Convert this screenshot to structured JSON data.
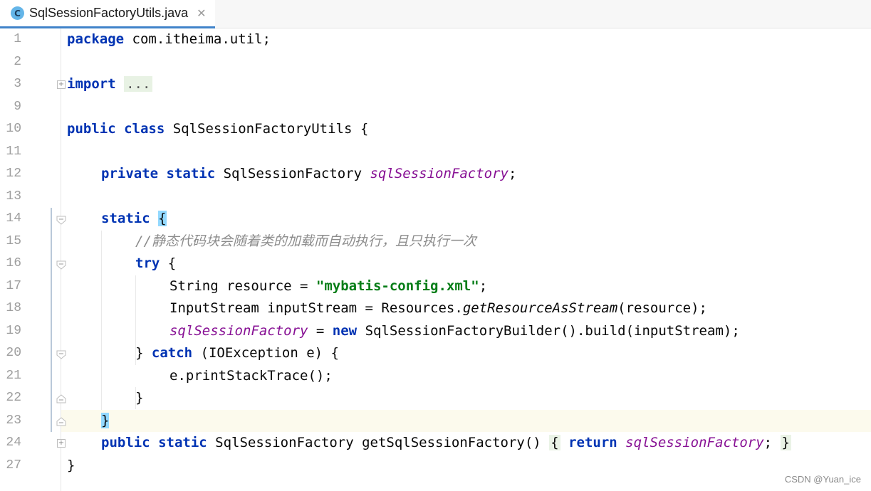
{
  "tab": {
    "icon_letter": "C",
    "title": "SqlSessionFactoryUtils.java",
    "close": "✕"
  },
  "line_numbers": [
    "1",
    "2",
    "3",
    "9",
    "10",
    "11",
    "12",
    "13",
    "14",
    "15",
    "16",
    "17",
    "18",
    "19",
    "20",
    "21",
    "22",
    "23",
    "24",
    "27"
  ],
  "code": {
    "l1_kw": "package",
    "l1_rest": " com.itheima.util;",
    "l3_kw": "import",
    "l3_folded": "...",
    "l10_kw1": "public",
    "l10_kw2": "class",
    "l10_rest": " SqlSessionFactoryUtils {",
    "l12_kw1": "private",
    "l12_kw2": "static",
    "l12_type": " SqlSessionFactory ",
    "l12_field": "sqlSessionFactory",
    "l12_end": ";",
    "l14_kw": "static",
    "l14_brace": "{",
    "l15_comment": "//静态代码块会随着类的加载而自动执行，且只执行一次",
    "l16_kw": "try",
    "l16_rest": " {",
    "l17_pre": "String resource = ",
    "l17_str": "\"mybatis-config.xml\"",
    "l17_end": ";",
    "l18_pre": "InputStream inputStream = Resources.",
    "l18_method": "getResourceAsStream",
    "l18_end": "(resource);",
    "l19_field": "sqlSessionFactory",
    "l19_mid": " = ",
    "l19_kw": "new",
    "l19_end": " SqlSessionFactoryBuilder().build(inputStream);",
    "l20_pre": "} ",
    "l20_kw": "catch",
    "l20_end": " (IOException e) {",
    "l21_text": "e.printStackTrace();",
    "l22_text": "}",
    "l23_brace": "}",
    "l24_kw1": "public",
    "l24_kw2": "static",
    "l24_mid": " SqlSessionFactory getSqlSessionFactory() ",
    "l24_open": "{",
    "l24_kw3": "return",
    "l24_field": "sqlSessionFactory",
    "l24_semi": ";",
    "l24_close": "}",
    "l27_text": "}"
  },
  "watermark": "CSDN @Yuan_ice",
  "colors": {
    "keyword": "#0033b3",
    "field": "#871094",
    "string": "#067d17",
    "comment": "#8c8c8c",
    "current_line": "#fcfaed",
    "tab_underline": "#4083c9"
  }
}
